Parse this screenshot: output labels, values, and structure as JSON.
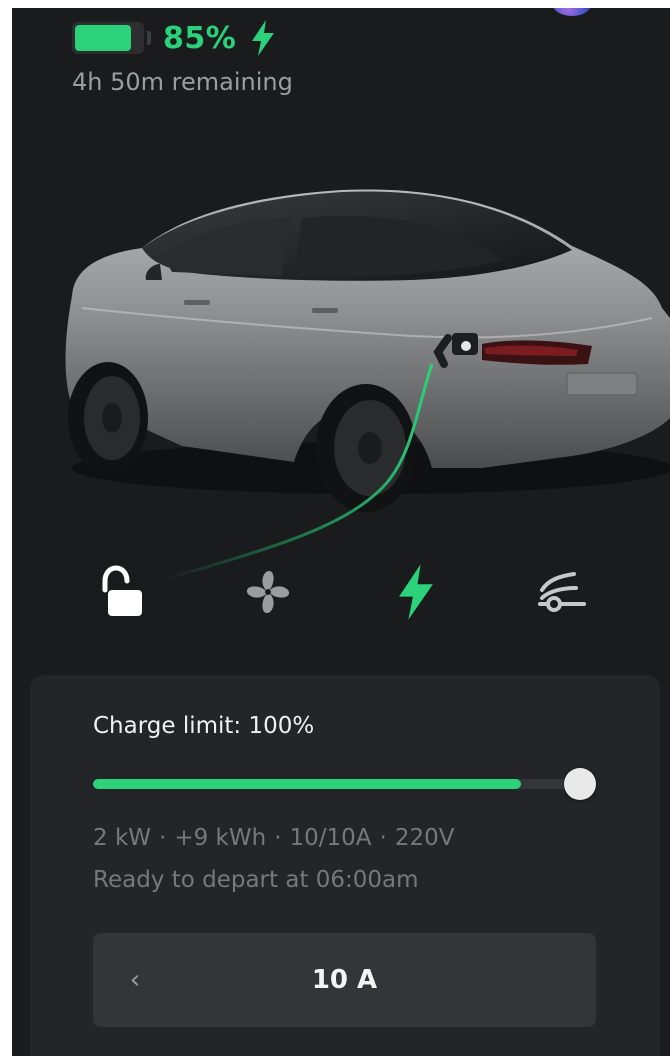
{
  "battery": {
    "percent_label": "85%",
    "level": 0.85,
    "remaining": "4h 50m remaining"
  },
  "controls": [
    {
      "id": "lock",
      "icon": "unlock-icon",
      "active": false
    },
    {
      "id": "climate",
      "icon": "fan-icon",
      "active": false
    },
    {
      "id": "charging",
      "icon": "lightning-bolt-icon",
      "active": true
    },
    {
      "id": "frunk",
      "icon": "frunk-icon",
      "active": false
    }
  ],
  "charge_panel": {
    "limit_label": "Charge limit: 100%",
    "limit_value": 100,
    "current_charge_fraction": 0.85,
    "stats": {
      "power": "2 kW",
      "energy": "+9 kWh",
      "current": "10/10A",
      "voltage": "220V",
      "separator": "·"
    },
    "depart_text": "Ready to depart at 06:00am",
    "amperage": {
      "prev_glyph": "‹",
      "value": "10 A"
    }
  },
  "colors": {
    "accent": "#2bd27a",
    "background": "#1a1b1d",
    "panel": "#242528",
    "text_muted": "#76787c"
  }
}
